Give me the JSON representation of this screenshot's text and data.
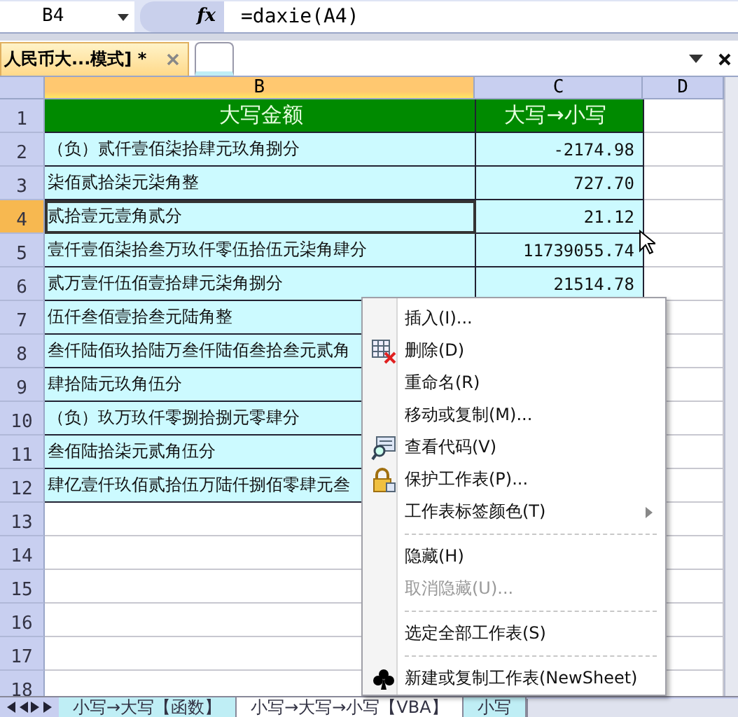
{
  "formula_bar": {
    "name_box": "B4",
    "fx": "fx",
    "formula": "=daxie(A4)"
  },
  "doc_tab": {
    "label": "人民币大...模式] *",
    "selected": true
  },
  "columns": [
    {
      "label": "B",
      "selected": true
    },
    {
      "label": "C",
      "selected": false
    },
    {
      "label": "D",
      "selected": false
    }
  ],
  "rows": [
    {
      "number": "1",
      "selected": false,
      "kind": "header",
      "b": "大写金额",
      "c": "大写→小写"
    },
    {
      "number": "2",
      "selected": false,
      "kind": "data",
      "b": "（负）贰仟壹佰柒拾肆元玖角捌分",
      "c": "-2174.98"
    },
    {
      "number": "3",
      "selected": false,
      "kind": "data",
      "b": "柒佰贰拾柒元柒角整",
      "c": "727.70"
    },
    {
      "number": "4",
      "selected": true,
      "kind": "data",
      "b": "贰拾壹元壹角贰分",
      "c": "21.12"
    },
    {
      "number": "5",
      "selected": false,
      "kind": "data",
      "b": "壹仟壹佰柒拾叁万玖仟零伍拾伍元柒角肆分",
      "c": "11739055.74"
    },
    {
      "number": "6",
      "selected": false,
      "kind": "data",
      "b": "贰万壹仟伍佰壹拾肆元柒角捌分",
      "c": "21514.78"
    },
    {
      "number": "7",
      "selected": false,
      "kind": "data",
      "b": "伍仟叁佰壹拾叁元陆角整"
    },
    {
      "number": "8",
      "selected": false,
      "kind": "data",
      "b": "叁仟陆佰玖拾陆万叁仟陆佰叁拾叁元贰角"
    },
    {
      "number": "9",
      "selected": false,
      "kind": "data",
      "b": "肆拾陆元玖角伍分"
    },
    {
      "number": "10",
      "selected": false,
      "kind": "data",
      "b": "（负）玖万玖仟零捌拾捌元零肆分"
    },
    {
      "number": "11",
      "selected": false,
      "kind": "data",
      "b": "叁佰陆拾柒元贰角伍分"
    },
    {
      "number": "12",
      "selected": false,
      "kind": "data",
      "b": "肆亿壹仟玖佰贰拾伍万陆仟捌佰零肆元叁"
    },
    {
      "number": "13",
      "selected": false,
      "kind": "empty"
    },
    {
      "number": "14",
      "selected": false,
      "kind": "empty"
    },
    {
      "number": "15",
      "selected": false,
      "kind": "empty"
    },
    {
      "number": "16",
      "selected": false,
      "kind": "empty"
    },
    {
      "number": "17",
      "selected": false,
      "kind": "empty"
    },
    {
      "number": "18",
      "selected": false,
      "kind": "empty"
    }
  ],
  "context_menu": [
    {
      "label": "插入(I)...",
      "kind": "plain",
      "disabled": false,
      "submenu": false,
      "separator_before": false
    },
    {
      "label": "删除(D)",
      "kind": "delete",
      "disabled": false,
      "submenu": false,
      "separator_before": false
    },
    {
      "label": "重命名(R)",
      "kind": "plain",
      "disabled": false,
      "submenu": false,
      "separator_before": false
    },
    {
      "label": "移动或复制(M)...",
      "kind": "plain",
      "disabled": false,
      "submenu": false,
      "separator_before": false
    },
    {
      "label": "查看代码(V)",
      "kind": "code",
      "disabled": false,
      "submenu": false,
      "separator_before": false
    },
    {
      "label": "保护工作表(P)...",
      "kind": "protect",
      "disabled": false,
      "submenu": false,
      "separator_before": false
    },
    {
      "label": "工作表标签颜色(T)",
      "kind": "plain",
      "disabled": false,
      "submenu": true,
      "separator_before": false
    },
    {
      "label": "隐藏(H)",
      "kind": "plain",
      "disabled": false,
      "submenu": false,
      "separator_before": true
    },
    {
      "label": "取消隐藏(U)...",
      "kind": "plain",
      "disabled": true,
      "submenu": false,
      "separator_before": false
    },
    {
      "label": "选定全部工作表(S)",
      "kind": "plain",
      "disabled": false,
      "submenu": false,
      "separator_before": true
    },
    {
      "label": "新建或复制工作表(NewSheet)",
      "kind": "club",
      "disabled": false,
      "submenu": false,
      "separator_before": true
    }
  ],
  "sheet_tabs": [
    {
      "label": "小写→大写【函数】",
      "selected": false
    },
    {
      "label": "小写→大写→小写【VBA】",
      "selected": true
    },
    {
      "label": "小写",
      "selected": false
    }
  ]
}
